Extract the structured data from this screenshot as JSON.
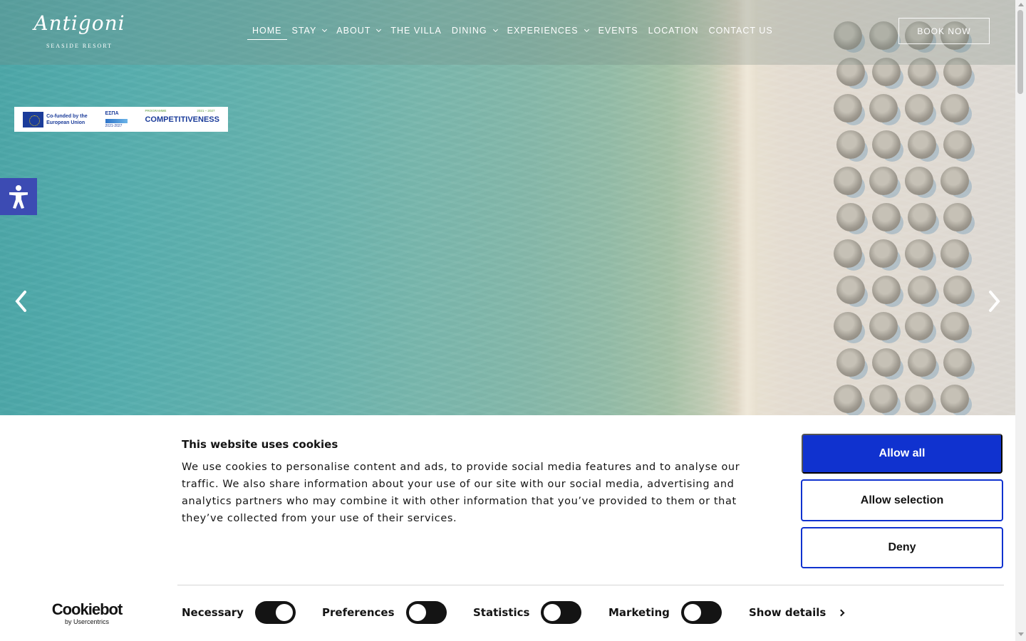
{
  "header": {
    "logo": {
      "name": "Antigoni",
      "tagline": "SEASIDE RESORT"
    },
    "nav": [
      {
        "label": "HOME",
        "active": true,
        "has_dropdown": false
      },
      {
        "label": "STAY",
        "active": false,
        "has_dropdown": true
      },
      {
        "label": "ABOUT",
        "active": false,
        "has_dropdown": true
      },
      {
        "label": "THE VILLA",
        "active": false,
        "has_dropdown": false
      },
      {
        "label": "DINING",
        "active": false,
        "has_dropdown": true
      },
      {
        "label": "EXPERIENCES",
        "active": false,
        "has_dropdown": true
      },
      {
        "label": "EVENTS",
        "active": false,
        "has_dropdown": false
      },
      {
        "label": "LOCATION",
        "active": false,
        "has_dropdown": false
      },
      {
        "label": "CONTACT US",
        "active": false,
        "has_dropdown": false
      }
    ],
    "book_button": "BOOK NOW"
  },
  "eu_banner": {
    "eu_text": "Co-funded by the European Union",
    "espa_text": "ΕΣΠΑ",
    "espa_years": "2021-2027",
    "programme_label": "PROGRAMME",
    "programme_years": "2021 – 2027",
    "programme_name": "COMPETITIVENESS"
  },
  "accessibility": {
    "icon": "accessibility-icon"
  },
  "slider": {
    "prev_icon": "chevron-left-icon",
    "next_icon": "chevron-right-icon"
  },
  "cookie_banner": {
    "title": "This website uses cookies",
    "text": "We use cookies to personalise content and ads, to provide social media features and to analyse our traffic. We also share information about your use of our site with our social media, advertising and analytics partners who may combine it with other information that you’ve provided to them or that they’ve collected from your use of their services.",
    "buttons": {
      "allow_all": "Allow all",
      "allow_selection": "Allow selection",
      "deny": "Deny"
    },
    "brand": {
      "name": "Cookiebot",
      "sub": "by Usercentrics"
    },
    "toggles": [
      {
        "label": "Necessary",
        "on": true
      },
      {
        "label": "Preferences",
        "on": false
      },
      {
        "label": "Statistics",
        "on": false
      },
      {
        "label": "Marketing",
        "on": false
      }
    ],
    "show_details": "Show details"
  },
  "colors": {
    "primary_blue": "#1032cf",
    "accessibility_blue": "#3c4bb3",
    "toggle_dark": "#141414"
  }
}
